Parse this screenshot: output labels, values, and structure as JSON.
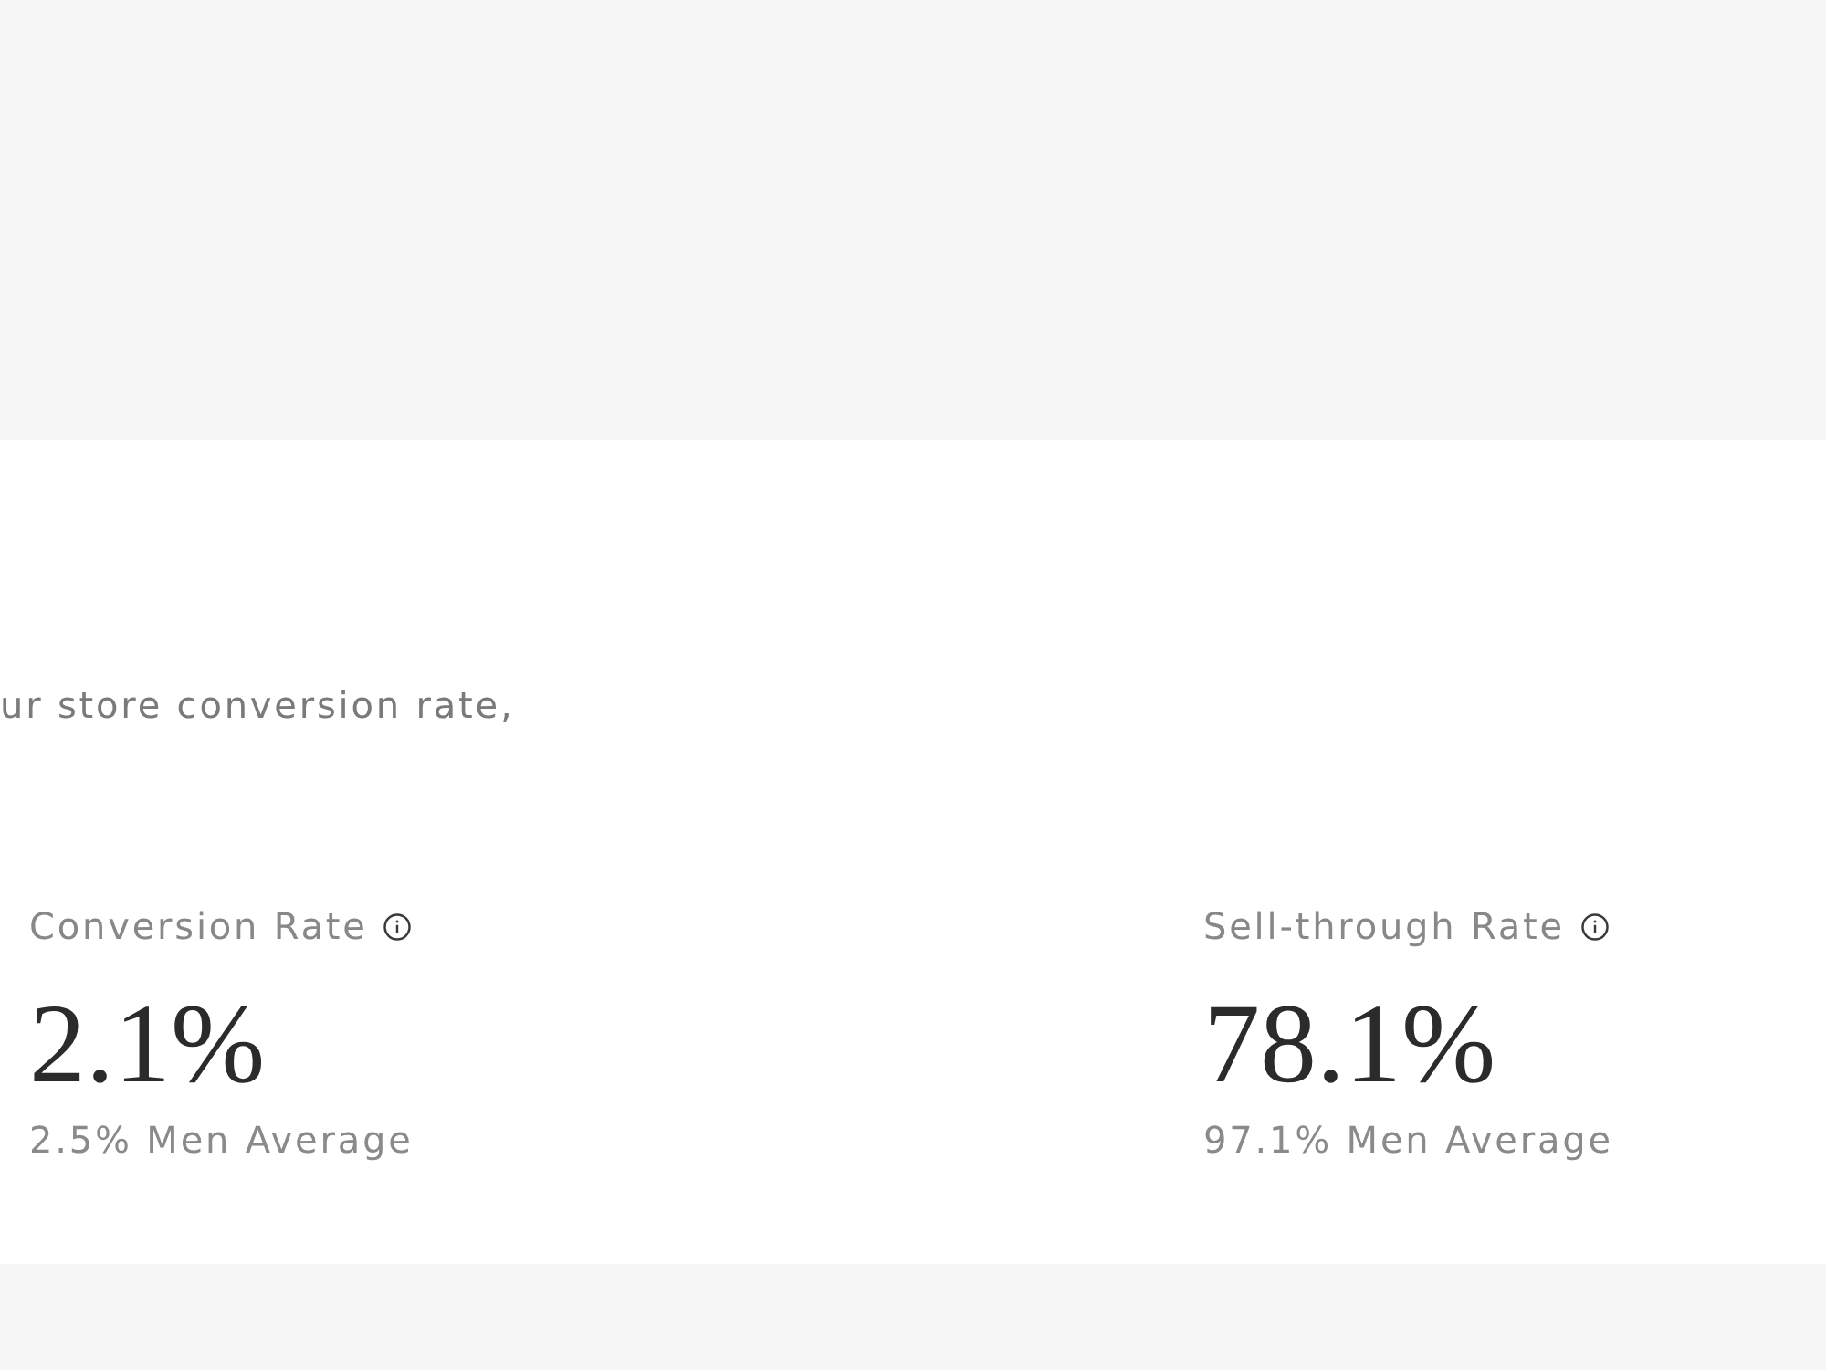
{
  "intro": {
    "text": "ur store conversion rate,"
  },
  "metrics": [
    {
      "label": "Conversion Rate",
      "value": "2.1%",
      "benchmark": "2.5% Men Average"
    },
    {
      "label": "Sell-through Rate",
      "value": "78.1%",
      "benchmark": "97.1% Men Average"
    }
  ]
}
